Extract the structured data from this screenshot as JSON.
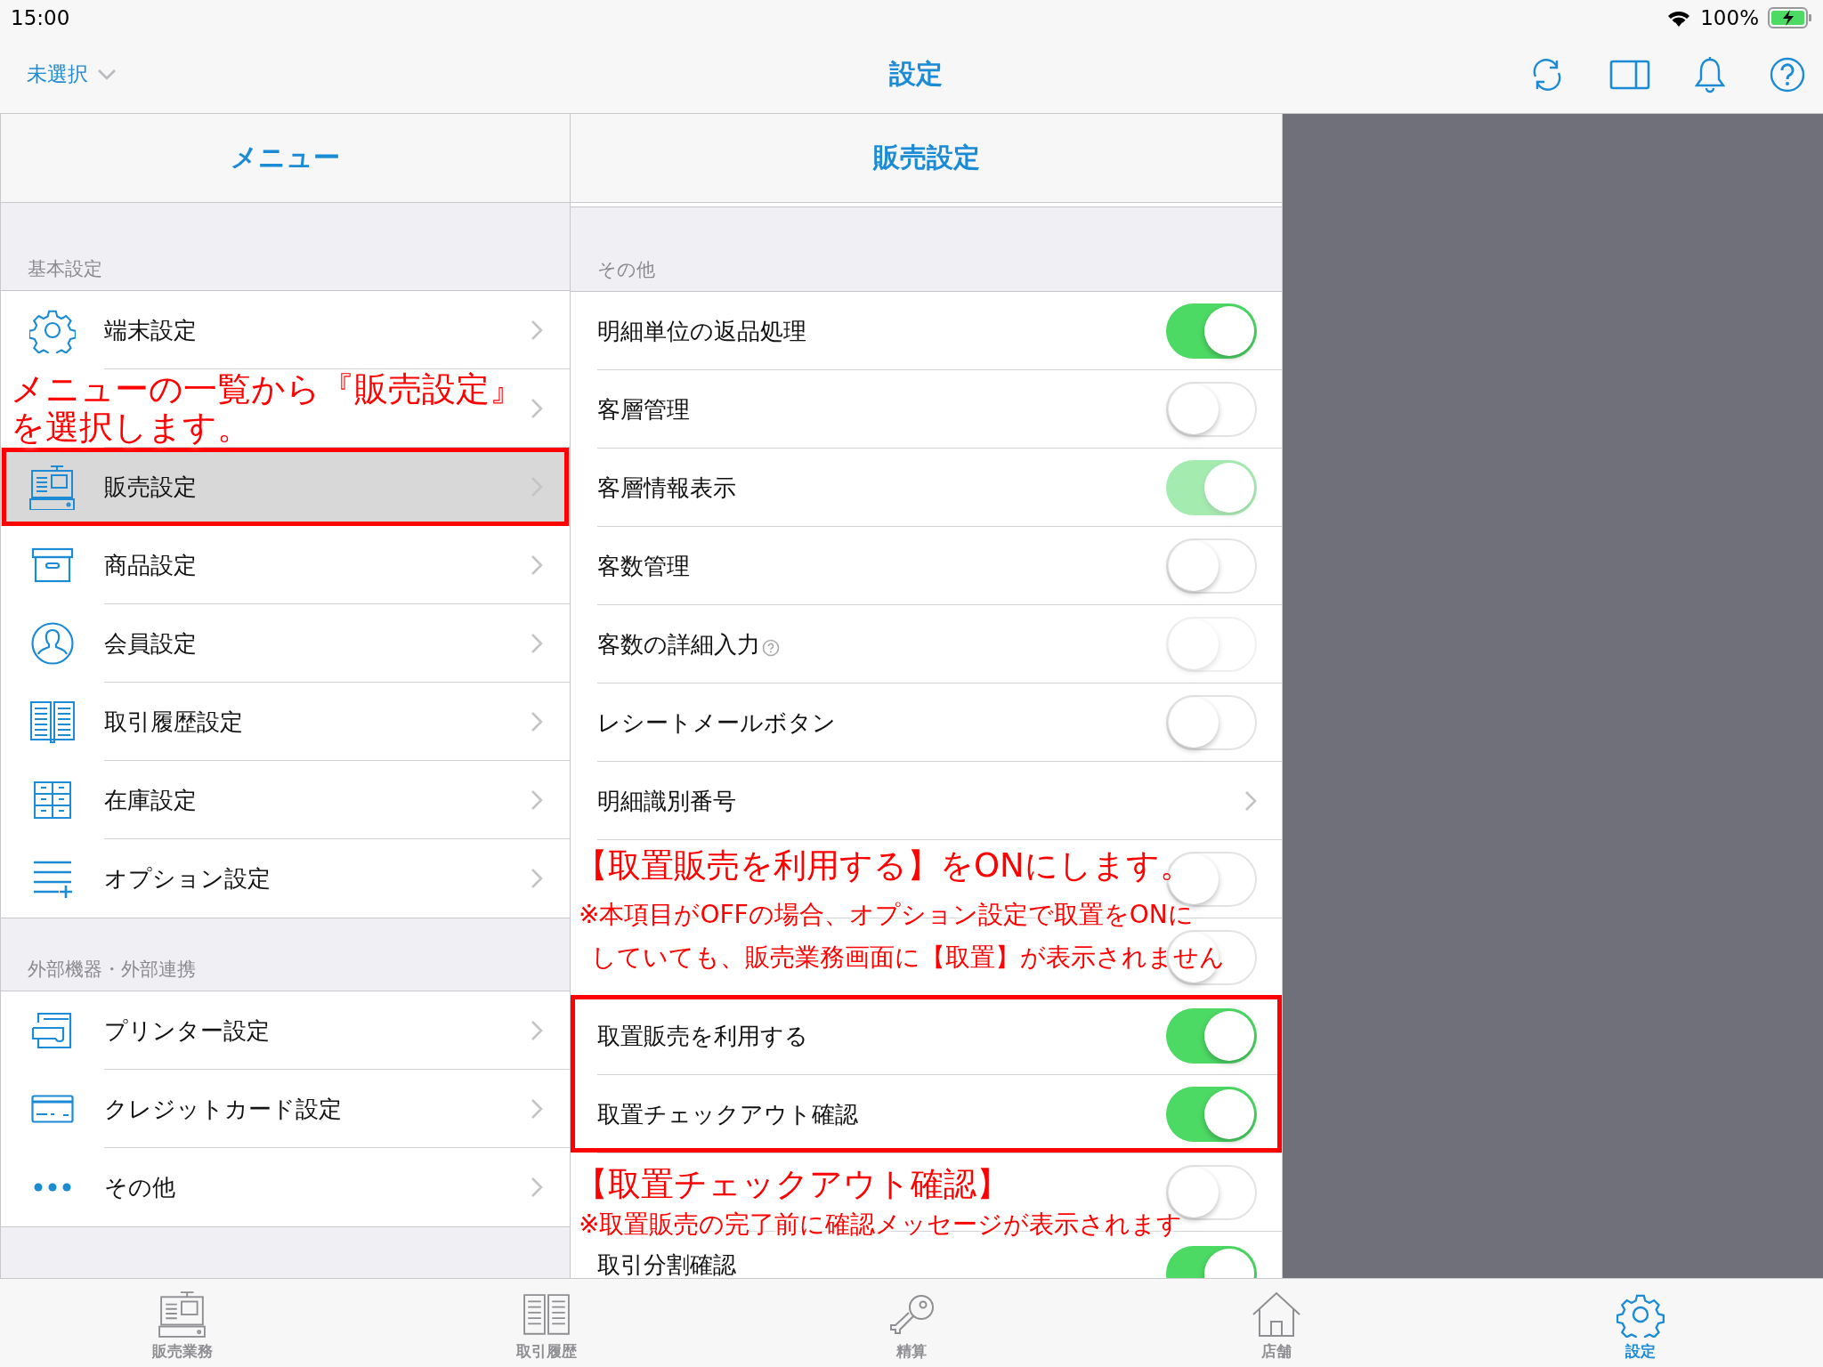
{
  "status_bar": {
    "time": "15:00",
    "battery": "100%"
  },
  "nav": {
    "store_picker": "未選択",
    "title": "設定"
  },
  "menu": {
    "title": "メニュー",
    "sections": [
      {
        "header": "基本設定",
        "items": [
          {
            "label": "端末設定",
            "selected": false
          },
          {
            "selected": false
          },
          {
            "label": "販売設定",
            "selected": true
          },
          {
            "label": "商品設定",
            "selected": false
          },
          {
            "label": "会員設定",
            "selected": false
          },
          {
            "label": "取引履歴設定",
            "selected": false
          },
          {
            "label": "在庫設定",
            "selected": false
          },
          {
            "label": "オプション設定",
            "selected": false
          }
        ]
      },
      {
        "header": "外部機器・外部連携",
        "items": [
          {
            "label": "プリンター設定",
            "selected": false
          },
          {
            "label": "クレジットカード設定",
            "selected": false
          },
          {
            "label": "その他",
            "selected": false
          }
        ]
      }
    ]
  },
  "detail": {
    "title": "販売設定",
    "section": "その他",
    "rows": [
      {
        "kind": "toggle",
        "label": "明細単位の返品処理",
        "on": true,
        "disabled": false
      },
      {
        "kind": "toggle",
        "label": "客層管理",
        "on": false,
        "disabled": false
      },
      {
        "kind": "toggle",
        "label": "客層情報表示",
        "on": true,
        "disabled": true
      },
      {
        "kind": "toggle",
        "label": "客数管理",
        "on": false,
        "disabled": false
      },
      {
        "kind": "toggle",
        "label": "客数の詳細入力",
        "help": true,
        "on": false,
        "disabled": true
      },
      {
        "kind": "toggle",
        "label": "レシートメールボタン",
        "on": false,
        "disabled": false
      },
      {
        "kind": "link",
        "label": "明細識別番号"
      },
      {
        "kind": "toggle",
        "on": false,
        "disabled": false
      },
      {
        "kind": "toggle",
        "on": false,
        "disabled": false
      },
      {
        "kind": "toggle",
        "label": "取置販売を利用する",
        "on": true,
        "disabled": false
      },
      {
        "kind": "toggle",
        "label": "取置チェックアウト確認",
        "on": true,
        "disabled": false
      },
      {
        "kind": "toggle",
        "on": false,
        "disabled": false
      },
      {
        "kind": "toggle",
        "label": "取引分割確認",
        "on": true,
        "disabled": false
      }
    ]
  },
  "annotations": [
    {
      "kind": "title",
      "text": "メニューの一覧から『販売設定』を選択します。"
    },
    {
      "kind": "title",
      "text": "【取置販売を利用する】をONにします。"
    },
    {
      "kind": "note",
      "text": "※本項目がOFFの場合、オプション設定で取置をONに"
    },
    {
      "kind": "note",
      "text": "していても、販売業務画面に【取置】が表示されません"
    },
    {
      "kind": "title",
      "text": "【取置チェックアウト確認】"
    },
    {
      "kind": "note",
      "text": "※取置販売の完了前に確認メッセージが表示されます"
    }
  ],
  "tabs": [
    {
      "label": "販売業務",
      "selected": false
    },
    {
      "label": "取引履歴",
      "selected": false
    },
    {
      "label": "精算",
      "selected": false
    },
    {
      "label": "店舗",
      "selected": false
    },
    {
      "label": "設定",
      "selected": true
    }
  ]
}
